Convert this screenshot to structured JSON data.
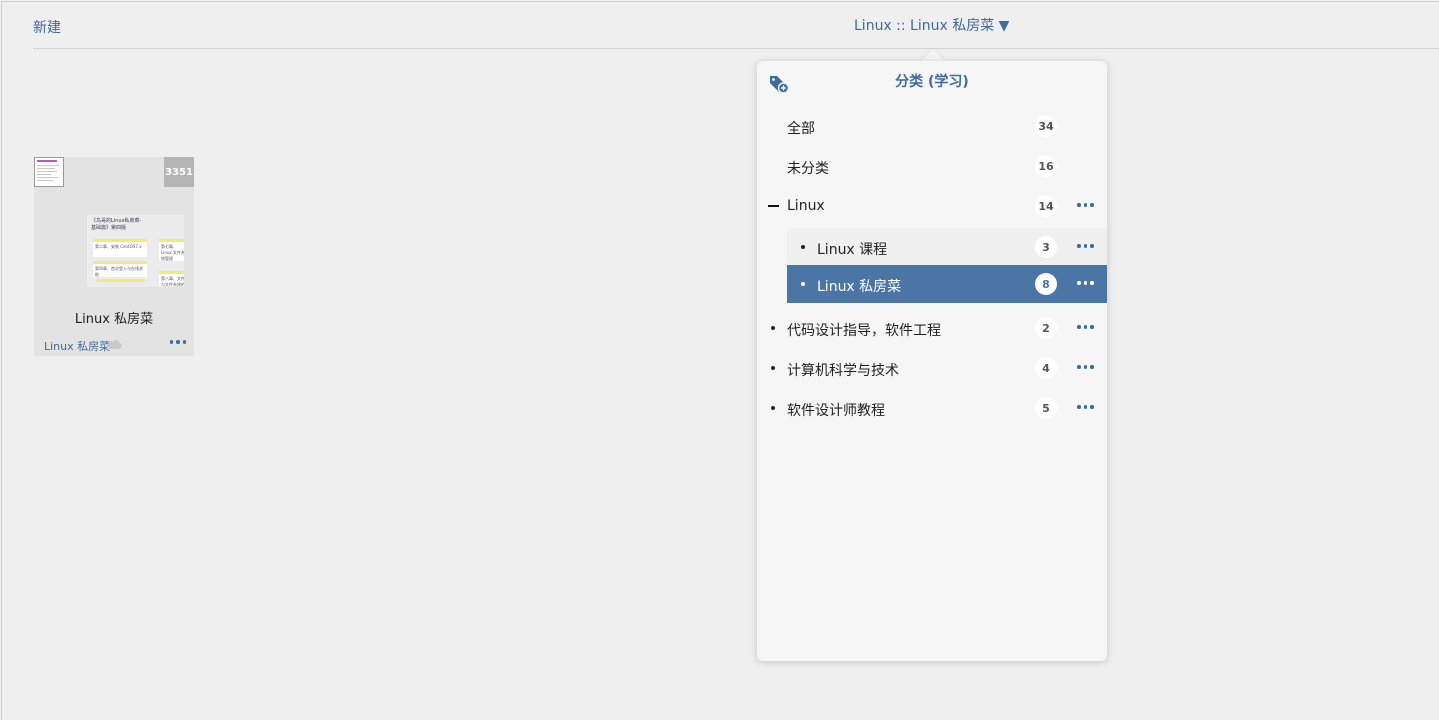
{
  "header": {
    "new_label": "新建",
    "title_selector": "Linux :: Linux 私房菜 ▼"
  },
  "card": {
    "count": "3351",
    "title": "Linux 私房菜",
    "category": "Linux 私房菜",
    "preview": {
      "heading": "《鸟哥的Linux私房菜-基础篇》第四版",
      "box1": "第二章、安装 CentOS7.x",
      "box2": "第七章、Linux 文件系统管理",
      "box3": "第四章、首次登入与在线求助",
      "box4": "第八章、文件与文件系统的压缩"
    }
  },
  "popover": {
    "title": "分类 (学习)",
    "rows": [
      {
        "label": "全部",
        "count": "34"
      },
      {
        "label": "未分类",
        "count": "16"
      },
      {
        "label": "Linux",
        "count": "14"
      },
      {
        "label": "Linux 课程",
        "count": "3"
      },
      {
        "label": "Linux 私房菜",
        "count": "8"
      },
      {
        "label": "代码设计指导，软件工程",
        "count": "2"
      },
      {
        "label": "计算机科学与技术",
        "count": "4"
      },
      {
        "label": "软件设计师教程",
        "count": "5"
      }
    ]
  },
  "colors": {
    "accent": "#3f6a9a",
    "selected_bg": "#4a75a5",
    "background": "#efefef"
  },
  "icons": {
    "tag_add": "tag-plus-icon",
    "cloud": "cloud-icon",
    "more": "more-dots-icon"
  }
}
